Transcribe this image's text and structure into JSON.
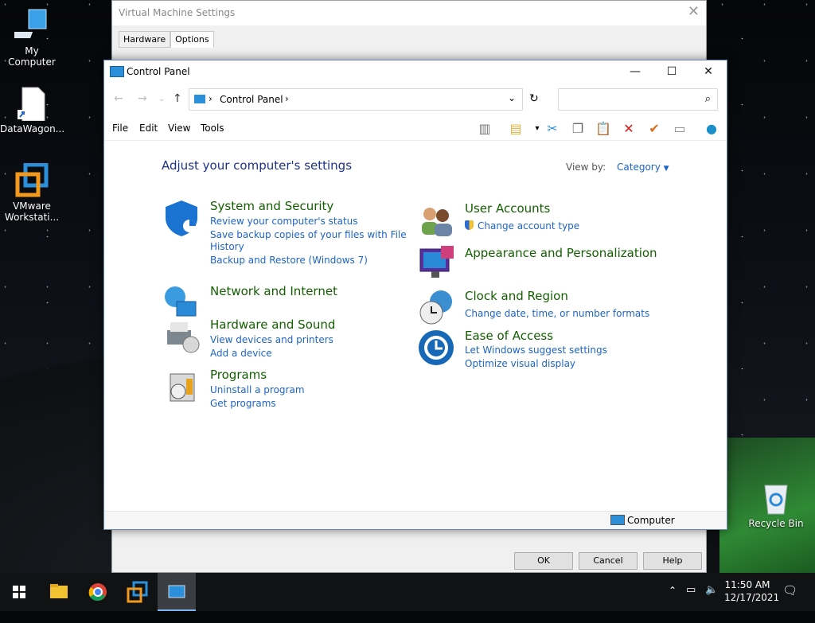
{
  "desktop": {
    "icons": [
      {
        "label": "My Computer"
      },
      {
        "label": "DataWagon..."
      },
      {
        "label": "VMware Workstati..."
      },
      {
        "label": "Recycle Bin"
      }
    ]
  },
  "vm_settings": {
    "title": "Virtual Machine Settings",
    "tabs": [
      "Hardware",
      "Options"
    ],
    "active_tab": "Options",
    "buttons": [
      "OK",
      "Cancel",
      "Help"
    ]
  },
  "control_panel": {
    "title": "Control Panel",
    "breadcrumb": "Control Panel",
    "search_placeholder": "",
    "menu": [
      "File",
      "Edit",
      "View",
      "Tools"
    ],
    "heading": "Adjust your computer's settings",
    "view_by_label": "View by:",
    "view_by_value": "Category",
    "categories": [
      {
        "title": "System and Security",
        "links": [
          "Review your computer's status",
          "Save backup copies of your files with File",
          "History",
          "Backup and Restore (Windows 7)"
        ]
      },
      {
        "title": "Network and Internet",
        "links": []
      },
      {
        "title": "Hardware and Sound",
        "links": [
          "View devices and printers",
          "Add a device"
        ]
      },
      {
        "title": "Programs",
        "links": [
          "Uninstall a program",
          "Get programs"
        ]
      },
      {
        "title": "User Accounts",
        "links": [
          "Change account type"
        ]
      },
      {
        "title": "Appearance and Personalization",
        "links": []
      },
      {
        "title": "Clock and Region",
        "links": [
          "Change date, time, or number formats"
        ]
      },
      {
        "title": "Ease of Access",
        "links": [
          "Let Windows suggest settings",
          "Optimize visual display"
        ]
      }
    ],
    "status_item": "Computer"
  },
  "taskbar": {
    "time": "11:50 AM",
    "date": "12/17/2021"
  },
  "colors": {
    "link": "#1e64c8",
    "category_title": "#136000",
    "heading": "#1e3287"
  }
}
